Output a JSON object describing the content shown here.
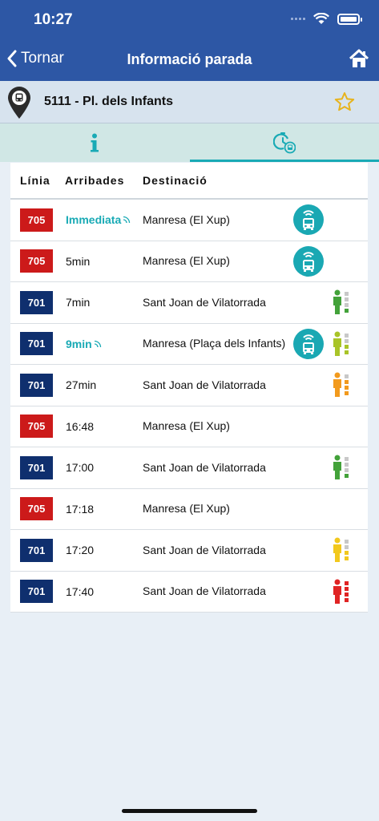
{
  "status": {
    "time": "10:27"
  },
  "nav": {
    "back_label": "Tornar",
    "title": "Informació parada"
  },
  "stop": {
    "name": "5111 - Pl. dels Infants"
  },
  "table": {
    "headers": {
      "line": "Línia",
      "arrivals": "Arribades",
      "destination": "Destinació"
    },
    "rows": [
      {
        "line": "705",
        "line_color": "#cc1a1a",
        "arrival": "Immediata",
        "realtime": true,
        "destination": "Manresa (El Xup)",
        "wifi_bus": true,
        "occupancy": null
      },
      {
        "line": "705",
        "line_color": "#cc1a1a",
        "arrival": "5min",
        "realtime": false,
        "destination": "Manresa (El Xup)",
        "wifi_bus": true,
        "occupancy": null
      },
      {
        "line": "701",
        "line_color": "#0f2f6e",
        "arrival": "7min",
        "realtime": false,
        "destination": "Sant Joan de Vilatorrada",
        "wifi_bus": false,
        "occupancy": {
          "level": 1,
          "color": "#43a23a"
        }
      },
      {
        "line": "701",
        "line_color": "#0f2f6e",
        "arrival": "9min",
        "realtime": true,
        "destination": "Manresa (Plaça dels Infants)",
        "wifi_bus": true,
        "occupancy": {
          "level": 2,
          "color": "#a9c428"
        }
      },
      {
        "line": "701",
        "line_color": "#0f2f6e",
        "arrival": "27min",
        "realtime": false,
        "destination": "Sant Joan de Vilatorrada",
        "wifi_bus": false,
        "occupancy": {
          "level": 3,
          "color": "#f29a1d"
        }
      },
      {
        "line": "705",
        "line_color": "#cc1a1a",
        "arrival": "16:48",
        "realtime": false,
        "destination": "Manresa (El Xup)",
        "wifi_bus": false,
        "occupancy": null
      },
      {
        "line": "701",
        "line_color": "#0f2f6e",
        "arrival": "17:00",
        "realtime": false,
        "destination": "Sant Joan de Vilatorrada",
        "wifi_bus": false,
        "occupancy": {
          "level": 1,
          "color": "#43a23a"
        }
      },
      {
        "line": "705",
        "line_color": "#cc1a1a",
        "arrival": "17:18",
        "realtime": false,
        "destination": "Manresa (El Xup)",
        "wifi_bus": false,
        "occupancy": null
      },
      {
        "line": "701",
        "line_color": "#0f2f6e",
        "arrival": "17:20",
        "realtime": false,
        "destination": "Sant Joan de Vilatorrada",
        "wifi_bus": false,
        "occupancy": {
          "level": 2,
          "color": "#f2c81d"
        }
      },
      {
        "line": "701",
        "line_color": "#0f2f6e",
        "arrival": "17:40",
        "realtime": false,
        "destination": "Sant Joan de Vilatorrada",
        "wifi_bus": false,
        "occupancy": {
          "level": 4,
          "color": "#e02424"
        }
      }
    ]
  },
  "colors": {
    "header": "#2d57a5",
    "accent": "#19aab5",
    "occupancy_empty": "#c8c8c8"
  },
  "icons": [
    "chevron-left-icon",
    "home-icon",
    "bus-stop-pin-icon",
    "star-outline-icon",
    "info-icon",
    "timer-bus-icon",
    "realtime-signal-icon",
    "wifi-bus-icon",
    "person-icon"
  ]
}
